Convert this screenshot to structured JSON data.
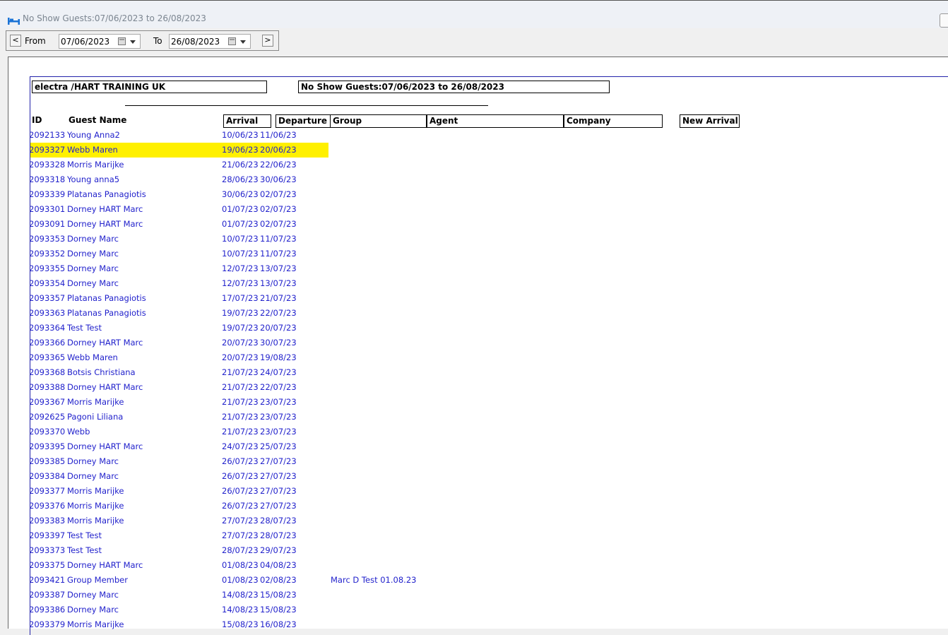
{
  "window": {
    "title": "No Show Guests:07/06/2023 to 26/08/2023",
    "icon": "bed-icon"
  },
  "toolbar": {
    "prev_label": "<",
    "next_label": ">",
    "from_label": "From",
    "from_value": "07/06/2023",
    "to_label": "To",
    "to_value": "26/08/2023"
  },
  "report": {
    "hotel": "electra /HART TRAINING UK",
    "title": "No Show Guests:07/06/2023 to 26/08/2023",
    "columns": {
      "id": "ID",
      "guest_name": "Guest Name",
      "arrival": "Arrival",
      "departure": "Departure",
      "group": "Group",
      "agent": "Agent",
      "company": "Company",
      "new_arrival": "New Arrival"
    },
    "rows": [
      {
        "id": "2092133",
        "name": "Young Anna2",
        "arrival": "10/06/23",
        "departure": "11/06/23",
        "group": ""
      },
      {
        "id": "2093327",
        "name": "Webb Maren",
        "arrival": "19/06/23",
        "departure": "20/06/23",
        "group": "",
        "highlighted": true
      },
      {
        "id": "2093328",
        "name": "Morris Marijke",
        "arrival": "21/06/23",
        "departure": "22/06/23",
        "group": ""
      },
      {
        "id": "2093318",
        "name": "Young anna5",
        "arrival": "28/06/23",
        "departure": "30/06/23",
        "group": ""
      },
      {
        "id": "2093339",
        "name": "Platanas Panagiotis",
        "arrival": "30/06/23",
        "departure": "02/07/23",
        "group": ""
      },
      {
        "id": "2093301",
        "name": "Dorney HART Marc",
        "arrival": "01/07/23",
        "departure": "02/07/23",
        "group": ""
      },
      {
        "id": "2093091",
        "name": "Dorney HART Marc",
        "arrival": "01/07/23",
        "departure": "02/07/23",
        "group": ""
      },
      {
        "id": "2093353",
        "name": "Dorney Marc",
        "arrival": "10/07/23",
        "departure": "11/07/23",
        "group": ""
      },
      {
        "id": "2093352",
        "name": "Dorney Marc",
        "arrival": "10/07/23",
        "departure": "11/07/23",
        "group": ""
      },
      {
        "id": "2093355",
        "name": "Dorney Marc",
        "arrival": "12/07/23",
        "departure": "13/07/23",
        "group": ""
      },
      {
        "id": "2093354",
        "name": "Dorney Marc",
        "arrival": "12/07/23",
        "departure": "13/07/23",
        "group": ""
      },
      {
        "id": "2093357",
        "name": "Platanas Panagiotis",
        "arrival": "17/07/23",
        "departure": "21/07/23",
        "group": ""
      },
      {
        "id": "2093363",
        "name": "Platanas Panagiotis",
        "arrival": "19/07/23",
        "departure": "22/07/23",
        "group": ""
      },
      {
        "id": "2093364",
        "name": "Test Test",
        "arrival": "19/07/23",
        "departure": "20/07/23",
        "group": ""
      },
      {
        "id": "2093366",
        "name": "Dorney HART Marc",
        "arrival": "20/07/23",
        "departure": "30/07/23",
        "group": ""
      },
      {
        "id": "2093365",
        "name": "Webb Maren",
        "arrival": "20/07/23",
        "departure": "19/08/23",
        "group": ""
      },
      {
        "id": "2093368",
        "name": "Botsis Christiana",
        "arrival": "21/07/23",
        "departure": "24/07/23",
        "group": ""
      },
      {
        "id": "2093388",
        "name": "Dorney HART Marc",
        "arrival": "21/07/23",
        "departure": "22/07/23",
        "group": ""
      },
      {
        "id": "2093367",
        "name": "Morris Marijke",
        "arrival": "21/07/23",
        "departure": "23/07/23",
        "group": ""
      },
      {
        "id": "2092625",
        "name": "Pagoni Liliana",
        "arrival": "21/07/23",
        "departure": "23/07/23",
        "group": ""
      },
      {
        "id": "2093370",
        "name": "Webb",
        "arrival": "21/07/23",
        "departure": "23/07/23",
        "group": ""
      },
      {
        "id": "2093395",
        "name": "Dorney HART Marc",
        "arrival": "24/07/23",
        "departure": "25/07/23",
        "group": ""
      },
      {
        "id": "2093385",
        "name": "Dorney Marc",
        "arrival": "26/07/23",
        "departure": "27/07/23",
        "group": ""
      },
      {
        "id": "2093384",
        "name": "Dorney Marc",
        "arrival": "26/07/23",
        "departure": "27/07/23",
        "group": ""
      },
      {
        "id": "2093377",
        "name": "Morris Marijke",
        "arrival": "26/07/23",
        "departure": "27/07/23",
        "group": ""
      },
      {
        "id": "2093376",
        "name": "Morris Marijke",
        "arrival": "26/07/23",
        "departure": "27/07/23",
        "group": ""
      },
      {
        "id": "2093383",
        "name": "Morris Marijke",
        "arrival": "27/07/23",
        "departure": "28/07/23",
        "group": ""
      },
      {
        "id": "2093397",
        "name": "Test Test",
        "arrival": "27/07/23",
        "departure": "28/07/23",
        "group": ""
      },
      {
        "id": "2093373",
        "name": "Test Test",
        "arrival": "28/07/23",
        "departure": "29/07/23",
        "group": ""
      },
      {
        "id": "2093375",
        "name": "Dorney HART Marc",
        "arrival": "01/08/23",
        "departure": "04/08/23",
        "group": ""
      },
      {
        "id": "2093421",
        "name": "Group Member",
        "arrival": "01/08/23",
        "departure": "02/08/23",
        "group": "Marc D Test 01.08.23"
      },
      {
        "id": "2093387",
        "name": "Dorney Marc",
        "arrival": "14/08/23",
        "departure": "15/08/23",
        "group": ""
      },
      {
        "id": "2093386",
        "name": "Dorney Marc",
        "arrival": "14/08/23",
        "departure": "15/08/23",
        "group": ""
      },
      {
        "id": "2093379",
        "name": "Morris Marijke",
        "arrival": "15/08/23",
        "departure": "16/08/23",
        "group": ""
      }
    ]
  },
  "colors": {
    "row_text": "#2222cc",
    "highlight": "#fff000"
  }
}
